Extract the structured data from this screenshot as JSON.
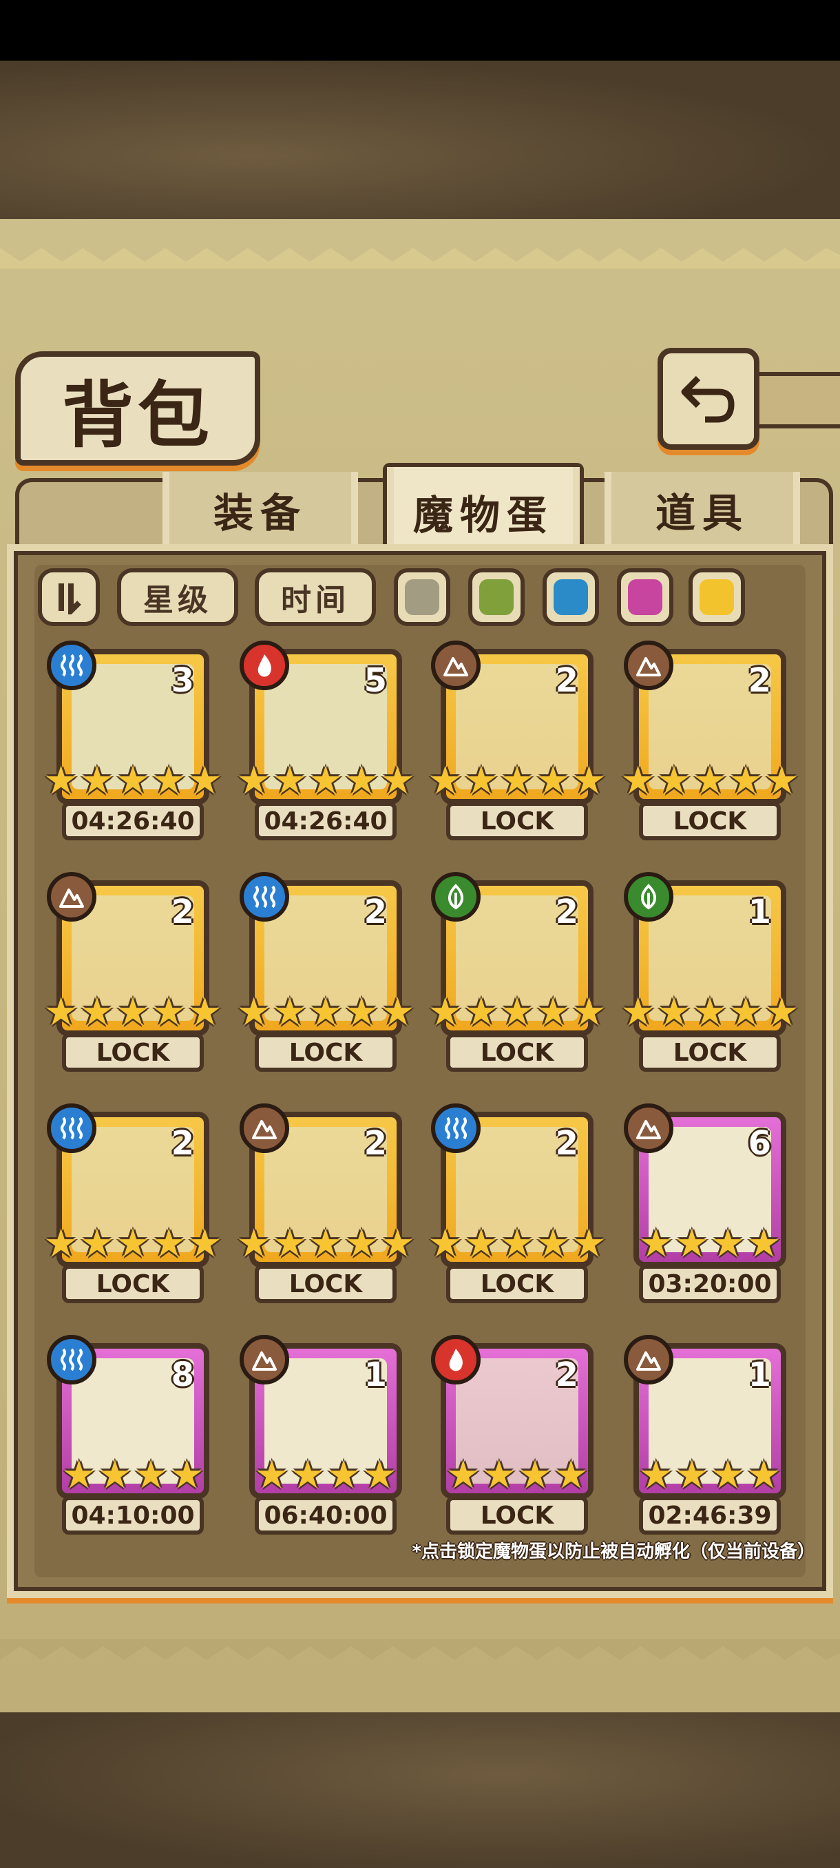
{
  "header": {
    "title": "背包"
  },
  "tabs": [
    {
      "label": "装备",
      "active": false
    },
    {
      "label": "魔物蛋",
      "active": true
    },
    {
      "label": "道具",
      "active": false
    }
  ],
  "filters": {
    "star_label": "星级",
    "time_label": "时间",
    "colors": [
      "#a19c82",
      "#7fa03b",
      "#2b8bc9",
      "#c7449f",
      "#f2c32c"
    ]
  },
  "element_colors": {
    "water": "#2a7fd3",
    "fire": "#d8342c",
    "earth": "#8a5a3c",
    "grass": "#3a8a2e"
  },
  "eggs": [
    {
      "count": "3",
      "stars": 5,
      "status": "04:26:40",
      "element": "water",
      "rarity": "gold"
    },
    {
      "count": "5",
      "stars": 5,
      "status": "04:26:40",
      "element": "fire",
      "rarity": "gold"
    },
    {
      "count": "2",
      "stars": 5,
      "status": "LOCK",
      "element": "earth",
      "rarity": "gold"
    },
    {
      "count": "2",
      "stars": 5,
      "status": "LOCK",
      "element": "earth",
      "rarity": "gold"
    },
    {
      "count": "2",
      "stars": 5,
      "status": "LOCK",
      "element": "earth",
      "rarity": "gold"
    },
    {
      "count": "2",
      "stars": 5,
      "status": "LOCK",
      "element": "water",
      "rarity": "gold"
    },
    {
      "count": "2",
      "stars": 5,
      "status": "LOCK",
      "element": "grass",
      "rarity": "gold"
    },
    {
      "count": "1",
      "stars": 5,
      "status": "LOCK",
      "element": "grass",
      "rarity": "gold"
    },
    {
      "count": "2",
      "stars": 5,
      "status": "LOCK",
      "element": "water",
      "rarity": "gold"
    },
    {
      "count": "2",
      "stars": 5,
      "status": "LOCK",
      "element": "earth",
      "rarity": "gold"
    },
    {
      "count": "2",
      "stars": 5,
      "status": "LOCK",
      "element": "water",
      "rarity": "gold"
    },
    {
      "count": "6",
      "stars": 4,
      "status": "03:20:00",
      "element": "earth",
      "rarity": "purple"
    },
    {
      "count": "8",
      "stars": 4,
      "status": "04:10:00",
      "element": "water",
      "rarity": "purple"
    },
    {
      "count": "1",
      "stars": 4,
      "status": "06:40:00",
      "element": "earth",
      "rarity": "purple"
    },
    {
      "count": "2",
      "stars": 4,
      "status": "LOCK",
      "element": "fire",
      "rarity": "purple"
    },
    {
      "count": "1",
      "stars": 4,
      "status": "02:46:39",
      "element": "earth",
      "rarity": "purple"
    }
  ],
  "footer_note": "*点击锁定魔物蛋以防止被自动孵化（仅当前设备）"
}
